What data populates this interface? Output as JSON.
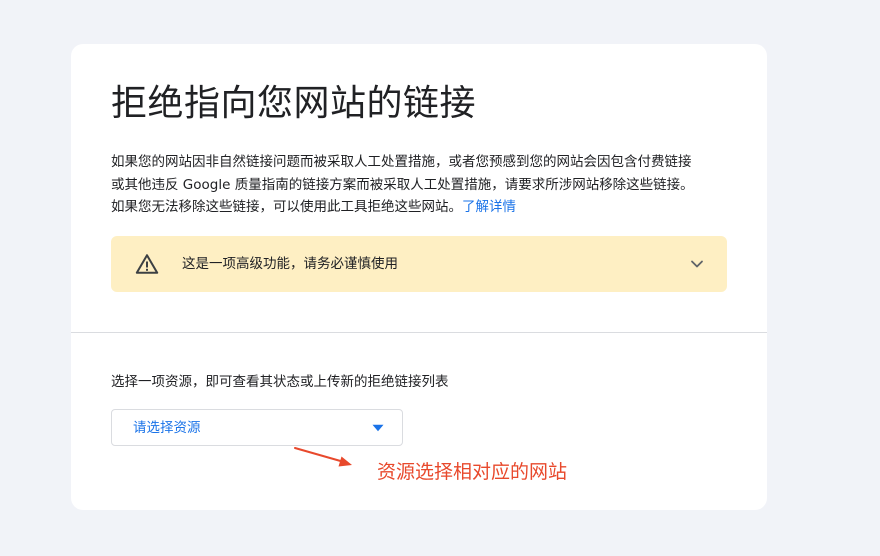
{
  "page": {
    "title": "拒绝指向您网站的链接",
    "description": "如果您的网站因非自然链接问题而被采取人工处置措施，或者您预感到您的网站会因包含付费链接或其他违反 Google 质量指南的链接方案而被采取人工处置措施，请要求所涉网站移除这些链接。如果您无法移除这些链接，可以使用此工具拒绝这些网站。",
    "learn_more_link": "了解详情"
  },
  "warning": {
    "text": "这是一项高级功能，请务必谨慎使用"
  },
  "property_selector": {
    "prompt": "选择一项资源，即可查看其状态或上传新的拒绝链接列表",
    "placeholder": "请选择资源"
  },
  "annotation": {
    "text": "资源选择相对应的网站"
  },
  "colors": {
    "background": "#f1f3f8",
    "card": "#ffffff",
    "warning_bg": "#feefc3",
    "link": "#1a73e8",
    "annotation": "#e8492c"
  },
  "icons": {
    "warning": "warning-triangle-icon",
    "expand": "chevron-down-icon",
    "dropdown": "caret-down-icon",
    "annotation": "arrow-icon"
  }
}
